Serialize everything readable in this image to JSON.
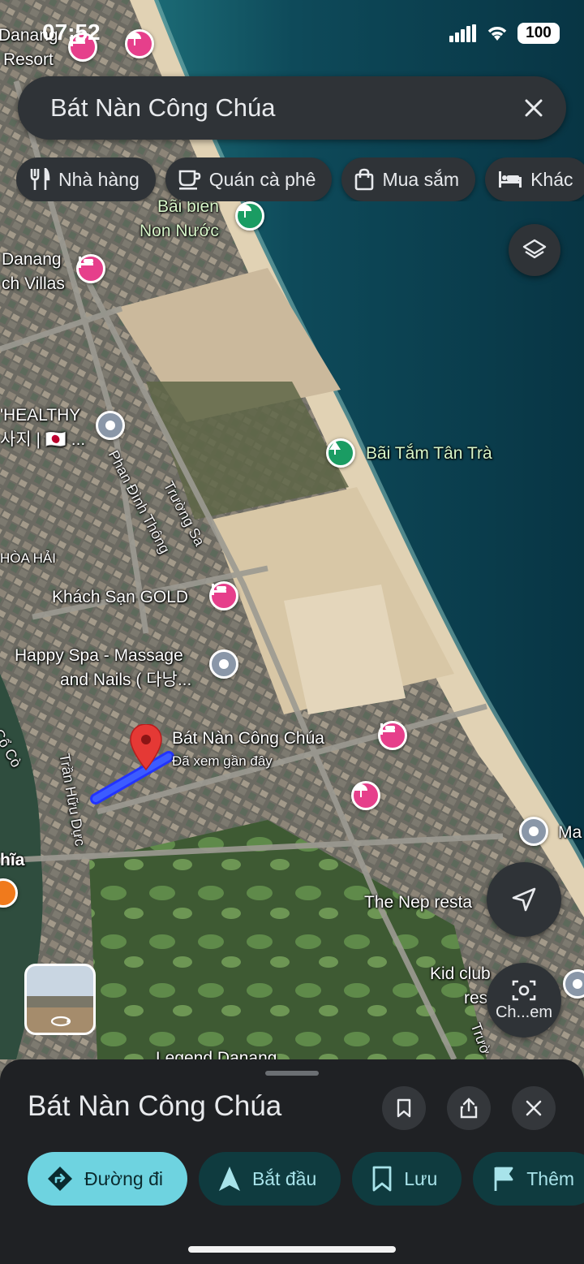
{
  "status": {
    "time": "07:52",
    "battery": "100"
  },
  "search": {
    "query": "Bát Nàn Công Chúa"
  },
  "chips": [
    {
      "label": "Nhà hàng",
      "icon": "restaurant-icon"
    },
    {
      "label": "Quán cà phê",
      "icon": "coffee-icon"
    },
    {
      "label": "Mua sắm",
      "icon": "shopping-bag-icon"
    },
    {
      "label": "Khác",
      "icon": "hotel-icon"
    }
  ],
  "map_labels": {
    "danang_resort_1": "Danang",
    "danang_resort_2": "Resort",
    "bai_bien_1": "Bãi biển",
    "bai_bien_2": "Non Nước",
    "villas_1": "Danang",
    "villas_2": "ch Villas",
    "healthy_1": "'HEALTHY",
    "healthy_2": "사지 | 🇯🇵 ...",
    "tan_tra": "Bãi Tắm Tân Trà",
    "phan_dinh_thong": "Phan Đình Thông",
    "truong_sa": "Trường Sa",
    "hoa_hai": "HÒA HẢI",
    "gold": "Khách Sạn GOLD",
    "spa_1": "Happy Spa - Massage",
    "spa_2": "and Nails ( 다낭...",
    "co_co": "n Cổ Cò",
    "place_name": "Bát Nàn Công Chúa",
    "place_sub": "Đã xem gần đây",
    "tran_huu_duc": "Trần Hữu Dực",
    "hia": "hĩa",
    "ma": "Ma",
    "nep": "The Nep resta",
    "kid_1": "Kid club",
    "kid_2": "resor",
    "truong_2": "Trườ",
    "legend": "Legend Danang",
    "camera_chip": "Ch...em"
  },
  "sheet": {
    "title": "Bát Nàn Công Chúa",
    "actions": [
      {
        "label": "Đường đi",
        "icon": "directions-icon"
      },
      {
        "label": "Bắt đầu",
        "icon": "navigation-arrow-icon"
      },
      {
        "label": "Lưu",
        "icon": "bookmark-icon"
      },
      {
        "label": "Thêm",
        "icon": "flag-icon"
      }
    ]
  },
  "colors": {
    "accent": "#6ed3e0",
    "pin_red": "#e53935",
    "route_blue": "#1a3fe0",
    "hotel_pink": "#e63f8b",
    "park_green": "#1a9c63"
  }
}
